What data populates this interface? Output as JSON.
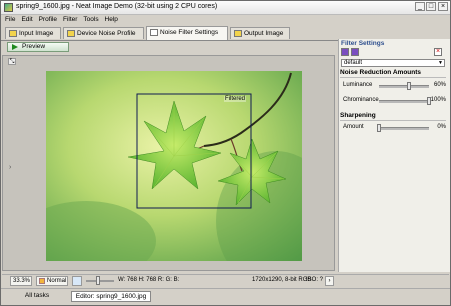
{
  "window": {
    "title": "spring9_1600.jpg - Neat Image Demo (32-bit using 2 CPU cores)",
    "controls": [
      "_",
      "□",
      "×"
    ]
  },
  "menu": [
    "File",
    "Edit",
    "Profile",
    "Filter",
    "Tools",
    "Help"
  ],
  "tabs": [
    {
      "label": "Input Image"
    },
    {
      "label": "Device Noise Profile"
    },
    {
      "label": "Noise Filter Settings"
    },
    {
      "label": "Output Image"
    }
  ],
  "toolbar": {
    "preview_label": "Preview"
  },
  "view": {
    "overlay_label": "Filtered"
  },
  "filter_panel": {
    "title": "Filter Settings",
    "preset": "default",
    "noise_section": "Noise Reduction Amounts",
    "sliders": [
      {
        "label": "Luminance",
        "value_text": "60%",
        "value": 0.6
      },
      {
        "label": "Chrominance",
        "value_text": "100%",
        "value": 1.0
      }
    ],
    "sharpening_section": "Sharpening",
    "amount": {
      "label": "Amount",
      "value_text": "0%",
      "value": 0.0
    }
  },
  "status": {
    "zoom": "33.3%",
    "mode": "Normal",
    "pixel_readout": "W: 768 H: 768  R:       G:       B:",
    "image_info": "1720x1290, 8-bit RGB",
    "iso": "ISO: ?"
  },
  "bottom_tabs": [
    {
      "label": "All tasks"
    },
    {
      "label": "Editor: spring9_1600.jpg"
    }
  ],
  "colors": {
    "accent": "#2e4f8e",
    "leaf": "#6fbf2a",
    "background_green": "#b8d870"
  }
}
